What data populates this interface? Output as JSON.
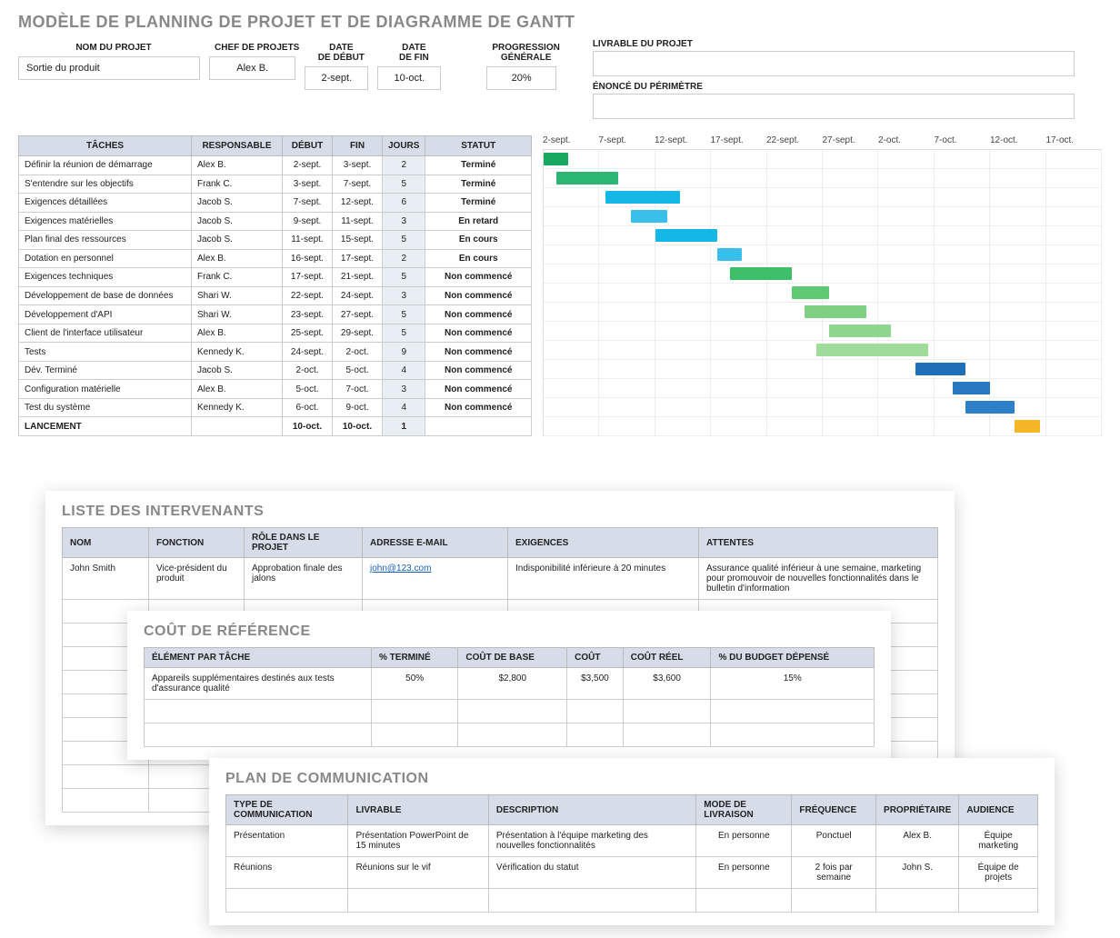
{
  "title": "MODÈLE DE PLANNING DE PROJET ET DE DIAGRAMME DE GANTT",
  "meta": {
    "headers": {
      "project_name": "NOM DU PROJET",
      "project_manager": "CHEF DE PROJETS",
      "start_date": "DATE\nDE DÉBUT",
      "end_date": "DATE\nDE FIN",
      "overall_progress": "PROGRESSION\nGÉNÉRALE",
      "deliverable": "LIVRABLE DU PROJET",
      "scope": "ÉNONCÉ DU PÉRIMÈTRE"
    },
    "values": {
      "project_name": "Sortie du produit",
      "project_manager": "Alex B.",
      "start_date": "2-sept.",
      "end_date": "10-oct.",
      "overall_progress": "20%"
    }
  },
  "tasks": {
    "headers": {
      "task": "TÂCHES",
      "owner": "RESPONSABLE",
      "start": "DÉBUT",
      "end": "FIN",
      "days": "JOURS",
      "status": "STATUT"
    },
    "rows": [
      {
        "task": "Définir la réunion de démarrage",
        "owner": "Alex B.",
        "start": "2-sept.",
        "end": "3-sept.",
        "days": "2",
        "status": "Terminé"
      },
      {
        "task": "S'entendre sur les objectifs",
        "owner": "Frank C.",
        "start": "3-sept.",
        "end": "7-sept.",
        "days": "5",
        "status": "Terminé"
      },
      {
        "task": "Exigences détaillées",
        "owner": "Jacob S.",
        "start": "7-sept.",
        "end": "12-sept.",
        "days": "6",
        "status": "Terminé"
      },
      {
        "task": "Exigences matérielles",
        "owner": "Jacob S.",
        "start": "9-sept.",
        "end": "11-sept.",
        "days": "3",
        "status": "En retard"
      },
      {
        "task": "Plan final des ressources",
        "owner": "Jacob S.",
        "start": "11-sept.",
        "end": "15-sept.",
        "days": "5",
        "status": "En cours"
      },
      {
        "task": "Dotation en personnel",
        "owner": "Alex B.",
        "start": "16-sept.",
        "end": "17-sept.",
        "days": "2",
        "status": "En cours"
      },
      {
        "task": "Exigences techniques",
        "owner": "Frank C.",
        "start": "17-sept.",
        "end": "21-sept.",
        "days": "5",
        "status": "Non commencé"
      },
      {
        "task": "Développement de base de données",
        "owner": "Shari W.",
        "start": "22-sept.",
        "end": "24-sept.",
        "days": "3",
        "status": "Non commencé"
      },
      {
        "task": "Développement d'API",
        "owner": "Shari W.",
        "start": "23-sept.",
        "end": "27-sept.",
        "days": "5",
        "status": "Non commencé"
      },
      {
        "task": "Client de l'interface utilisateur",
        "owner": "Alex B.",
        "start": "25-sept.",
        "end": "29-sept.",
        "days": "5",
        "status": "Non commencé"
      },
      {
        "task": "Tests",
        "owner": "Kennedy K.",
        "start": "24-sept.",
        "end": "2-oct.",
        "days": "9",
        "status": "Non commencé"
      },
      {
        "task": "Dév. Terminé",
        "owner": "Jacob S.",
        "start": "2-oct.",
        "end": "5-oct.",
        "days": "4",
        "status": "Non commencé"
      },
      {
        "task": "Configuration matérielle",
        "owner": "Alex B.",
        "start": "5-oct.",
        "end": "7-oct.",
        "days": "3",
        "status": "Non commencé"
      },
      {
        "task": "Test du système",
        "owner": "Kennedy K.",
        "start": "6-oct.",
        "end": "9-oct.",
        "days": "4",
        "status": "Non commencé"
      },
      {
        "task": "LANCEMENT",
        "owner": "",
        "start": "10-oct.",
        "end": "10-oct.",
        "days": "1",
        "status": ""
      }
    ]
  },
  "chart_data": {
    "type": "gantt",
    "x_ticks": [
      "2-sept.",
      "7-sept.",
      "12-sept.",
      "17-sept.",
      "22-sept.",
      "27-sept.",
      "2-oct.",
      "7-oct.",
      "12-oct.",
      "17-oct."
    ],
    "x_start_day": 2,
    "x_end_day": 47,
    "bars": [
      {
        "start_day": 2,
        "end_day": 3,
        "color": "c-g1"
      },
      {
        "start_day": 3,
        "end_day": 7,
        "color": "c-g2"
      },
      {
        "start_day": 7,
        "end_day": 12,
        "color": "c-b1"
      },
      {
        "start_day": 9,
        "end_day": 11,
        "color": "c-b2"
      },
      {
        "start_day": 11,
        "end_day": 15,
        "color": "c-b1"
      },
      {
        "start_day": 16,
        "end_day": 17,
        "color": "c-b2"
      },
      {
        "start_day": 17,
        "end_day": 21,
        "color": "c-g3"
      },
      {
        "start_day": 22,
        "end_day": 24,
        "color": "c-g4"
      },
      {
        "start_day": 23,
        "end_day": 27,
        "color": "c-g5"
      },
      {
        "start_day": 25,
        "end_day": 29,
        "color": "c-g6"
      },
      {
        "start_day": 24,
        "end_day": 32,
        "color": "c-g7"
      },
      {
        "start_day": 32,
        "end_day": 35,
        "color": "c-db1"
      },
      {
        "start_day": 35,
        "end_day": 37,
        "color": "c-db2"
      },
      {
        "start_day": 36,
        "end_day": 39,
        "color": "c-db3"
      },
      {
        "start_day": 40,
        "end_day": 41,
        "color": "c-or"
      }
    ]
  },
  "stakeholders": {
    "title": "LISTE DES INTERVENANTS",
    "headers": {
      "name": "NOM",
      "function": "FONCTION",
      "role": "RÔLE DANS LE PROJET",
      "email": "ADRESSE E-MAIL",
      "requirements": "EXIGENCES",
      "expectations": "ATTENTES"
    },
    "rows": [
      {
        "name": "John Smith",
        "function": "Vice-président du produit",
        "role": "Approbation finale des jalons",
        "email": "john@123.com",
        "requirements": "Indisponibilité inférieure à 20 minutes",
        "expectations": "Assurance qualité inférieur à une semaine, marketing pour promouvoir de nouvelles fonctionnalités dans le bulletin d'information"
      }
    ]
  },
  "cost": {
    "title": "COÛT DE RÉFÉRENCE",
    "headers": {
      "item": "ÉLÉMENT PAR TÂCHE",
      "pct": "% TERMINÉ",
      "base": "COÛT DE BASE",
      "cost": "COÛT",
      "actual": "COÛT RÉEL",
      "budget": "% DU BUDGET DÉPENSÉ"
    },
    "rows": [
      {
        "item": "Appareils supplémentaires destinés aux tests d'assurance qualité",
        "pct": "50%",
        "base": "$2,800",
        "cost": "$3,500",
        "actual": "$3,600",
        "budget": "15%"
      }
    ]
  },
  "comm": {
    "title": "PLAN DE COMMUNICATION",
    "headers": {
      "type": "TYPE DE COMMUNICATION",
      "deliverable": "LIVRABLE",
      "desc": "DESCRIPTION",
      "mode": "MODE DE LIVRAISON",
      "freq": "FRÉQUENCE",
      "owner": "PROPRIÉTAIRE",
      "audience": "AUDIENCE"
    },
    "rows": [
      {
        "type": "Présentation",
        "deliverable": "Présentation PowerPoint de 15 minutes",
        "desc": "Présentation à l'équipe marketing des nouvelles fonctionnalités",
        "mode": "En personne",
        "freq": "Ponctuel",
        "owner": "Alex B.",
        "audience": "Équipe marketing"
      },
      {
        "type": "Réunions",
        "deliverable": "Réunions sur le vif",
        "desc": "Vérification du statut",
        "mode": "En personne",
        "freq": "2 fois par semaine",
        "owner": "John S.",
        "audience": "Équipe de projets"
      }
    ]
  }
}
